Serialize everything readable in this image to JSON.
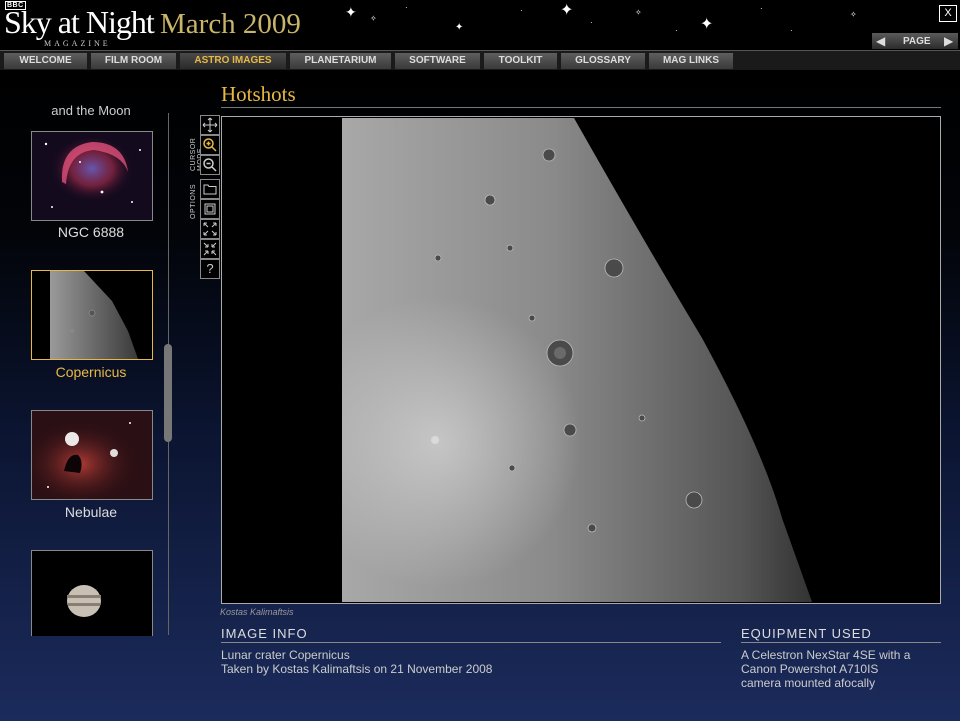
{
  "header": {
    "bbc": "BBC",
    "brand": "Sky at Night",
    "magazine": "MAGAZINE",
    "issue": "March 2009",
    "close_label": "X",
    "page_label": "PAGE",
    "prev_arrow": "◀",
    "next_arrow": "▶"
  },
  "nav": {
    "tabs": [
      {
        "label": "WELCOME"
      },
      {
        "label": "FILM ROOM"
      },
      {
        "label": "ASTRO IMAGES",
        "active": true
      },
      {
        "label": "PLANETARIUM"
      },
      {
        "label": "SOFTWARE"
      },
      {
        "label": "TOOLKIT"
      },
      {
        "label": "GLOSSARY"
      },
      {
        "label": "MAG LINKS"
      }
    ]
  },
  "sidebar": {
    "clipped_caption": "and the Moon",
    "items": [
      {
        "label": "NGC 6888"
      },
      {
        "label": "Copernicus",
        "selected": true
      },
      {
        "label": "Nebulae"
      },
      {
        "label": ""
      }
    ]
  },
  "tools": {
    "cursor_mode_label": "CURSOR MODE",
    "options_label": "OPTIONS",
    "help_label": "?"
  },
  "main": {
    "section_title": "Hotshots",
    "photo_credit": "Kostas Kalimaftsis",
    "image_info_title": "IMAGE INFO",
    "image_info_line1": "Lunar crater Copernicus",
    "image_info_line2": "Taken by Kostas Kalimaftsis on 21 November 2008",
    "equipment_title": "EQUIPMENT USED",
    "equipment_line1": "A Celestron NexStar 4SE with a",
    "equipment_line2": "Canon Powershot A710IS",
    "equipment_line3": "camera mounted afocally"
  },
  "colors": {
    "accent": "#e8b844",
    "background": "#000000",
    "gradient_bottom": "#1b2b5c"
  },
  "icons": [
    "move-icon",
    "zoom-in-icon",
    "zoom-out-icon",
    "open-folder-icon",
    "frame-icon",
    "expand-icon",
    "contract-icon",
    "help-icon"
  ]
}
